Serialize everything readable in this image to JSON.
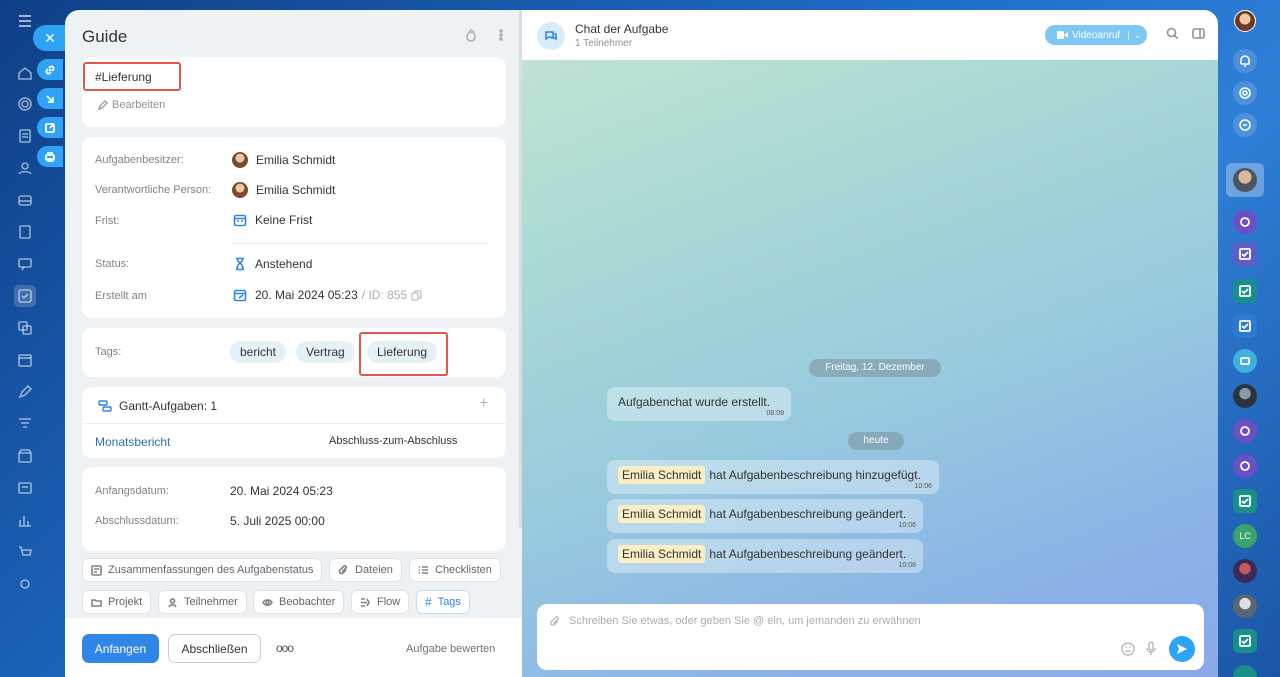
{
  "task": {
    "title": "Guide",
    "description_tag": "#Lieferung",
    "edit_label": "Bearbeiten",
    "fields": {
      "owner_label": "Aufgabenbesitzer:",
      "owner_value": "Emilia Schmidt",
      "responsible_label": "Verantwortliche Person:",
      "responsible_value": "Emilia Schmidt",
      "deadline_label": "Frist:",
      "deadline_value": "Keine Frist",
      "status_label": "Status:",
      "status_value": "Anstehend",
      "created_label": "Erstellt am",
      "created_value": "20. Mai 2024 05:23",
      "id_label": "/ ID: 855"
    },
    "tags_label": "Tags:",
    "tags": [
      "bericht",
      "Vertrag",
      "Lieferung"
    ],
    "gantt": {
      "title": "Gantt-Aufgaben: 1",
      "task_link": "Monatsbericht",
      "relation": "Abschluss-zum-Abschluss"
    },
    "dates": {
      "start_label": "Anfangsdatum:",
      "start_value": "20. Mai 2024 05:23",
      "end_label": "Abschlussdatum:",
      "end_value": "5. Juli 2025 00:00"
    },
    "chips": [
      "Zusammenfassungen des Aufgabenstatus",
      "Dateien",
      "Checklisten",
      "Projekt",
      "Teilnehmer",
      "Beobachter",
      "Flow",
      "Tags"
    ],
    "footer": {
      "start_button": "Anfangen",
      "complete_button": "Abschließen",
      "more_label": "ooo",
      "rate_label": "Aufgabe bewerten"
    }
  },
  "chat": {
    "title": "Chat der Aufgabe",
    "subtitle": "1 Teilnehmer",
    "video_button": "Videoanruf",
    "date_pill_1": "Freitag, 12. Dezember",
    "date_pill_2": "heute",
    "messages": [
      {
        "name": "",
        "text": "Aufgabenchat wurde erstellt.",
        "time": "08:09"
      },
      {
        "name": "Emilia Schmidt",
        "text": "hat Aufgabenbeschreibung hinzugefügt.",
        "time": "10:06"
      },
      {
        "name": "Emilia Schmidt",
        "text": "hat Aufgabenbeschreibung geändert.",
        "time": "10:06"
      },
      {
        "name": "Emilia Schmidt",
        "text": "hat Aufgabenbeschreibung geändert.",
        "time": "10:08"
      }
    ],
    "composer_placeholder": "Schreiben Sie etwas, oder geben Sie @ ein, um jemanden zu erwähnen"
  },
  "right_rail": {
    "initials": "LC"
  },
  "colors": {
    "accent": "#2f86e8",
    "highlight": "#e0584a",
    "name_badge": "#fbeec4"
  }
}
